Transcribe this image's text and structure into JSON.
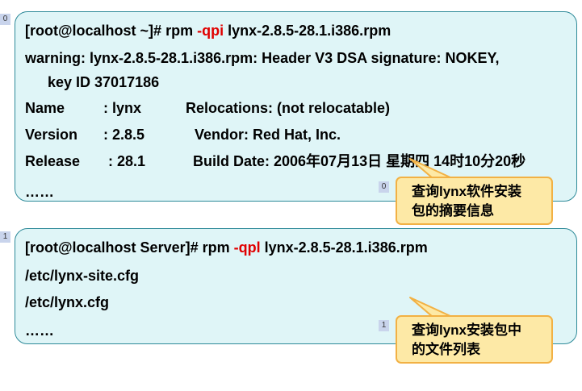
{
  "markers": {
    "panel1": "0",
    "panel2": "1",
    "callout1": "0",
    "callout2": "1"
  },
  "panel1": {
    "cmd_prefix": "[root@localhost ~]# rpm ",
    "cmd_flag": "-qpi",
    "cmd_suffix": " lynx-2.8.5-28.1.i386.rpm",
    "warning_line1": "warning: lynx-2.8.5-28.1.i386.rpm: Header V3 DSA signature: NOKEY,",
    "warning_line2": "key ID 37017186",
    "name_label": "Name",
    "name_value": ": lynx",
    "relocations": "Relocations: (not relocatable)",
    "version_label": "Version",
    "version_value": ": 2.8.5",
    "vendor": "Vendor: Red Hat, Inc.",
    "release_label": "Release",
    "release_value": ": 28.1",
    "build_date": "Build Date: 2006年07月13日 星期四 14时10分20秒",
    "ellipsis": "……"
  },
  "panel2": {
    "cmd_prefix": "[root@localhost Server]# rpm ",
    "cmd_flag": "-qpl",
    "cmd_suffix": " lynx-2.8.5-28.1.i386.rpm",
    "file1": "/etc/lynx-site.cfg",
    "file2": "/etc/lynx.cfg",
    "ellipsis": "……"
  },
  "callout1": {
    "line1": "查询lynx软件安装",
    "line2": "包的摘要信息"
  },
  "callout2": {
    "line1": "查询lynx安装包中",
    "line2": "的文件列表"
  },
  "colors": {
    "panel_bg": "#dff5f7",
    "panel_border": "#2e8a99",
    "flag_red": "#e00000",
    "callout_bg": "#fde9a6",
    "callout_border": "#f2b144",
    "marker_bg": "#c9d4ec"
  }
}
